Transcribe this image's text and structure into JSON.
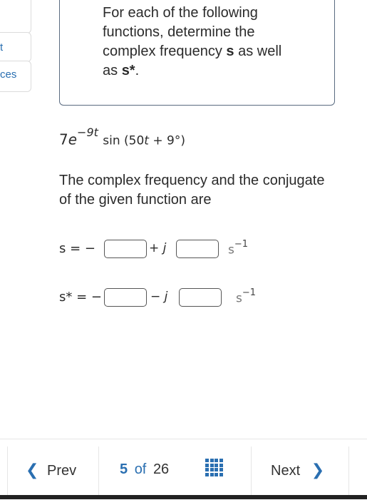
{
  "sidebar": {
    "partial_text_1": "t",
    "partial_text_2": "ces"
  },
  "question": {
    "intro": "For each of the following functions, determine the complex frequency ",
    "s_label": "s",
    "mid": " as well as ",
    "sconj_label": "s*",
    "end": "."
  },
  "expression": {
    "coef": "7",
    "e": "e",
    "exponent": "−9t",
    "func": "sin (50",
    "t": "t",
    "rest": " + 9°)"
  },
  "statement": "The complex frequency and the conjugate of the given function are",
  "answers": {
    "row1": {
      "lhs": "s = −",
      "mid": "+ j",
      "unit": "s",
      "unit_exp": "−1"
    },
    "row2": {
      "lhs": "s* = −",
      "mid": "− j",
      "unit": "s",
      "unit_exp": "−1"
    }
  },
  "nav": {
    "prev_label": "Prev",
    "prev_icon": "chevron-left-icon",
    "current": "5",
    "of": "of",
    "total": "26",
    "next_label": "Next",
    "next_icon": "chevron-right-icon",
    "accent_color": "#2a6fb1"
  }
}
